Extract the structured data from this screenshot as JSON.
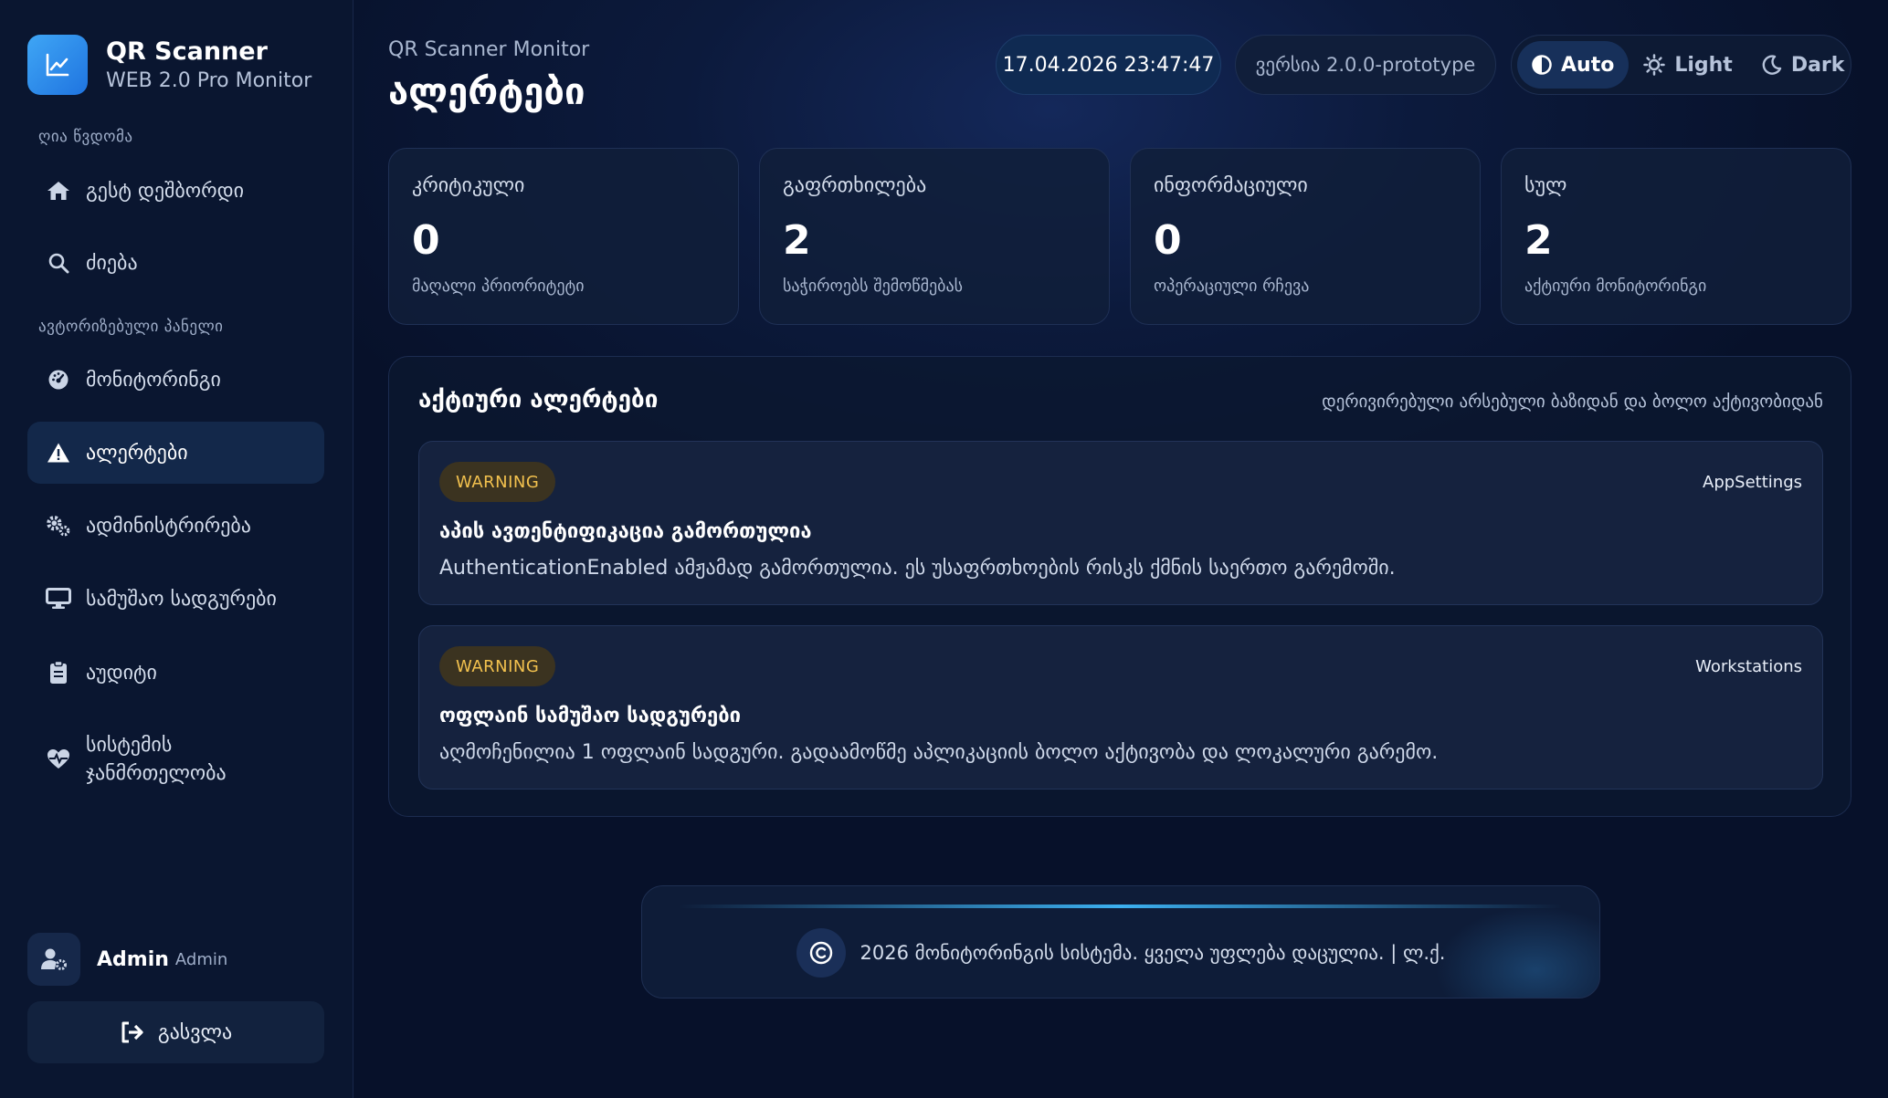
{
  "brand": {
    "title": "QR Scanner",
    "subtitle": "WEB 2.0 Pro Monitor",
    "logo_icon": "chart-line-icon"
  },
  "sidebar": {
    "public_section": "ღია წვდომა",
    "public_items": [
      {
        "label": "გესტ დეშბორდი",
        "icon": "home-icon"
      },
      {
        "label": "ძიება",
        "icon": "search-icon"
      }
    ],
    "auth_section": "ავტორიზებული პანელი",
    "auth_items": [
      {
        "label": "მონიტორინგი",
        "icon": "gauge-icon"
      },
      {
        "label": "ალერტები",
        "icon": "warning-icon",
        "active": true
      },
      {
        "label": "ადმინისტრირება",
        "icon": "gears-icon"
      },
      {
        "label": "სამუშაო სადგურები",
        "icon": "desktop-icon"
      },
      {
        "label": "აუდიტი",
        "icon": "clipboard-icon"
      },
      {
        "label": "სისტემის ჯანმრთელობა",
        "icon": "heart-pulse-icon"
      }
    ],
    "user": {
      "name": "Admin",
      "role": "Admin",
      "icon": "user-gear-icon"
    },
    "logout_label": "გასვლა"
  },
  "header": {
    "kicker": "QR Scanner Monitor",
    "title": "ალერტები",
    "datetime": "17.04.2026 23:47:47",
    "version": "ვერსია 2.0.0-prototype",
    "theme": {
      "auto": "Auto",
      "light": "Light",
      "dark": "Dark",
      "selected": "Auto"
    }
  },
  "stats": [
    {
      "label": "კრიტიკული",
      "value": "0",
      "sub": "მაღალი პრიორიტეტი"
    },
    {
      "label": "გაფრთხილება",
      "value": "2",
      "sub": "საჭიროებს შემოწმებას"
    },
    {
      "label": "ინფორმაციული",
      "value": "0",
      "sub": "ოპერაციული რჩევა"
    },
    {
      "label": "სულ",
      "value": "2",
      "sub": "აქტიური მონიტორინგი"
    }
  ],
  "alerts": {
    "title": "აქტიური ალერტები",
    "note": "დერივირებული არსებული ბაზიდან და ბოლო აქტივობიდან",
    "items": [
      {
        "level": "WARNING",
        "source": "AppSettings",
        "title": "აპის ავთენტიფიკაცია გამორთულია",
        "text": "AuthenticationEnabled ამჟამად გამორთულია. ეს უსაფრთხოების რისკს ქმნის საერთო გარემოში."
      },
      {
        "level": "WARNING",
        "source": "Workstations",
        "title": "ოფლაინ სამუშაო სადგურები",
        "text": "აღმოჩენილია 1 ოფლაინ სადგური. გადაამოწმე აპლიკაციის ბოლო აქტივობა და ლოკალური გარემო."
      }
    ]
  },
  "footer": {
    "text": "2026 მონიტორინგის სისტემა. ყველა უფლება დაცულია. | ლ.ქ.",
    "icon": "copyright-icon"
  },
  "colors": {
    "accent": "#3fa6f5",
    "warning": "#f2c14e",
    "background": "#07112a",
    "sidebar": "#0a1630"
  }
}
